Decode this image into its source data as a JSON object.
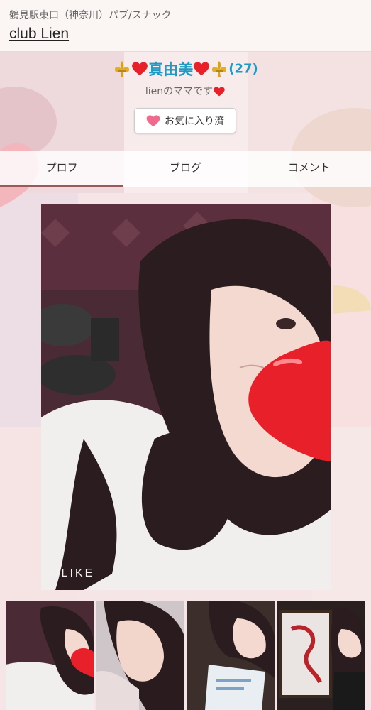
{
  "header": {
    "area": "鶴見駅東口（神奈川）パブ/スナック",
    "shop_name": "club Lien"
  },
  "profile": {
    "name": "真由美",
    "age": "(27)",
    "subtitle": "lienのママです",
    "favorite_label": "お気に入り済"
  },
  "tabs": [
    {
      "label": "プロフ",
      "active": true
    },
    {
      "label": "ブログ",
      "active": false
    },
    {
      "label": "コメント",
      "active": false
    }
  ],
  "main_photo": {
    "watermark": "ULIKE"
  },
  "colors": {
    "name": "#1d9bc5",
    "tab_indicator": "#9b5a5a",
    "heart": "#e8202a"
  }
}
